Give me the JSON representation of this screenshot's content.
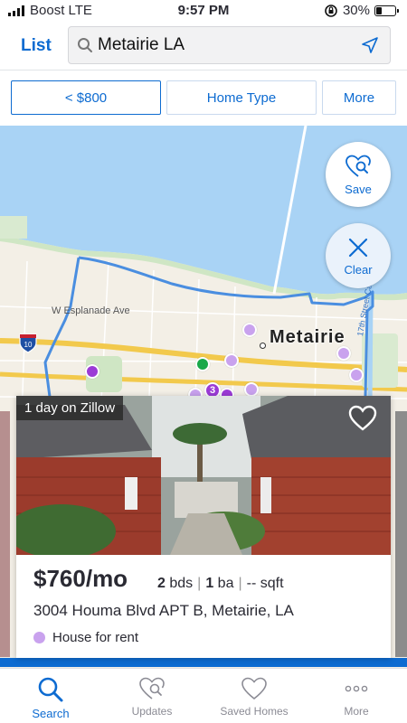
{
  "status_bar": {
    "carrier": "Boost LTE",
    "time": "9:57 PM",
    "battery": "30%",
    "battery_level": 0.3
  },
  "header": {
    "list_link": "List",
    "search_value": "Metairie LA"
  },
  "filters": {
    "price": "< $800",
    "home_type": "Home Type",
    "more": "More"
  },
  "map": {
    "save_label": "Save",
    "clear_label": "Clear",
    "city_label": "Metairie",
    "road_label": "W Esplanade Ave",
    "canal_label": "17th Street Canal",
    "interstate": "10",
    "cluster_count": "3"
  },
  "listing": {
    "badge": "1 day on Zillow",
    "price": "$760/mo",
    "beds_value": "2",
    "beds_unit": "bds",
    "baths_value": "1",
    "baths_unit": "ba",
    "sqft": "-- sqft",
    "address": "3004 Houma Blvd APT B, Metairie, LA",
    "type": "House for rent"
  },
  "tabbar": {
    "search": "Search",
    "updates": "Updates",
    "saved": "Saved Homes",
    "more": "More"
  },
  "colors": {
    "accent": "#0d6bd1",
    "pin": "#c9a2ee",
    "water": "#a9d3f5",
    "boundary": "#4a8ee0"
  }
}
